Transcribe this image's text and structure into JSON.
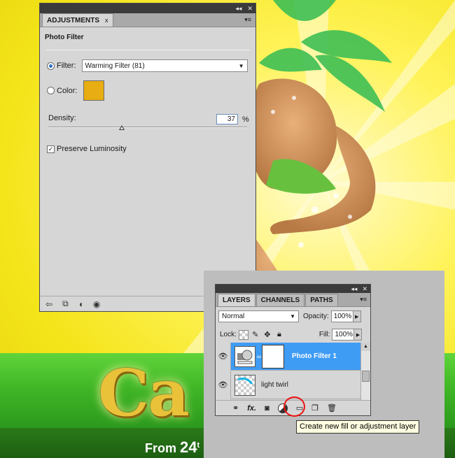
{
  "adjustments": {
    "tab_label": "ADJUSTMENTS",
    "tab_close": "x",
    "strip_collapse": "◂◂",
    "strip_close": "✕",
    "menu_glyph": "▾≡",
    "title": "Photo Filter",
    "filter_label": "Filter:",
    "filter_value": "Warming Filter (81)",
    "filter_selected": true,
    "color_label": "Color:",
    "color_value": "#e8ad12",
    "density_label": "Density:",
    "density_value": "37",
    "density_unit": "%",
    "density_fraction": 0.37,
    "preserve_label": "Preserve Luminosity",
    "preserve_checked": true,
    "footer_icons": [
      "back-arrow-icon",
      "clip-to-layer-icon",
      "layer-visibility-mask-icon",
      "eye-icon"
    ]
  },
  "layers": {
    "strip_collapse": "◂◂",
    "strip_close": "✕",
    "tabs": [
      {
        "label": "LAYERS",
        "active": true
      },
      {
        "label": "CHANNELS",
        "active": false
      },
      {
        "label": "PATHS",
        "active": false
      }
    ],
    "menu_glyph": "▾≡",
    "blend_mode": "Normal",
    "opacity_label": "Opacity:",
    "opacity_value": "100%",
    "lock_label": "Lock:",
    "fill_label": "Fill:",
    "fill_value": "100%",
    "layer_list": [
      {
        "name": "Photo Filter 1",
        "selected": true
      },
      {
        "name": "light twirl",
        "selected": false
      }
    ],
    "tooltip": "Create new fill or adjustment layer"
  },
  "artwork": {
    "title": "Ca",
    "subtitle_prefix": "From",
    "subtitle_number": "24",
    "subtitle_suffix": "t"
  }
}
